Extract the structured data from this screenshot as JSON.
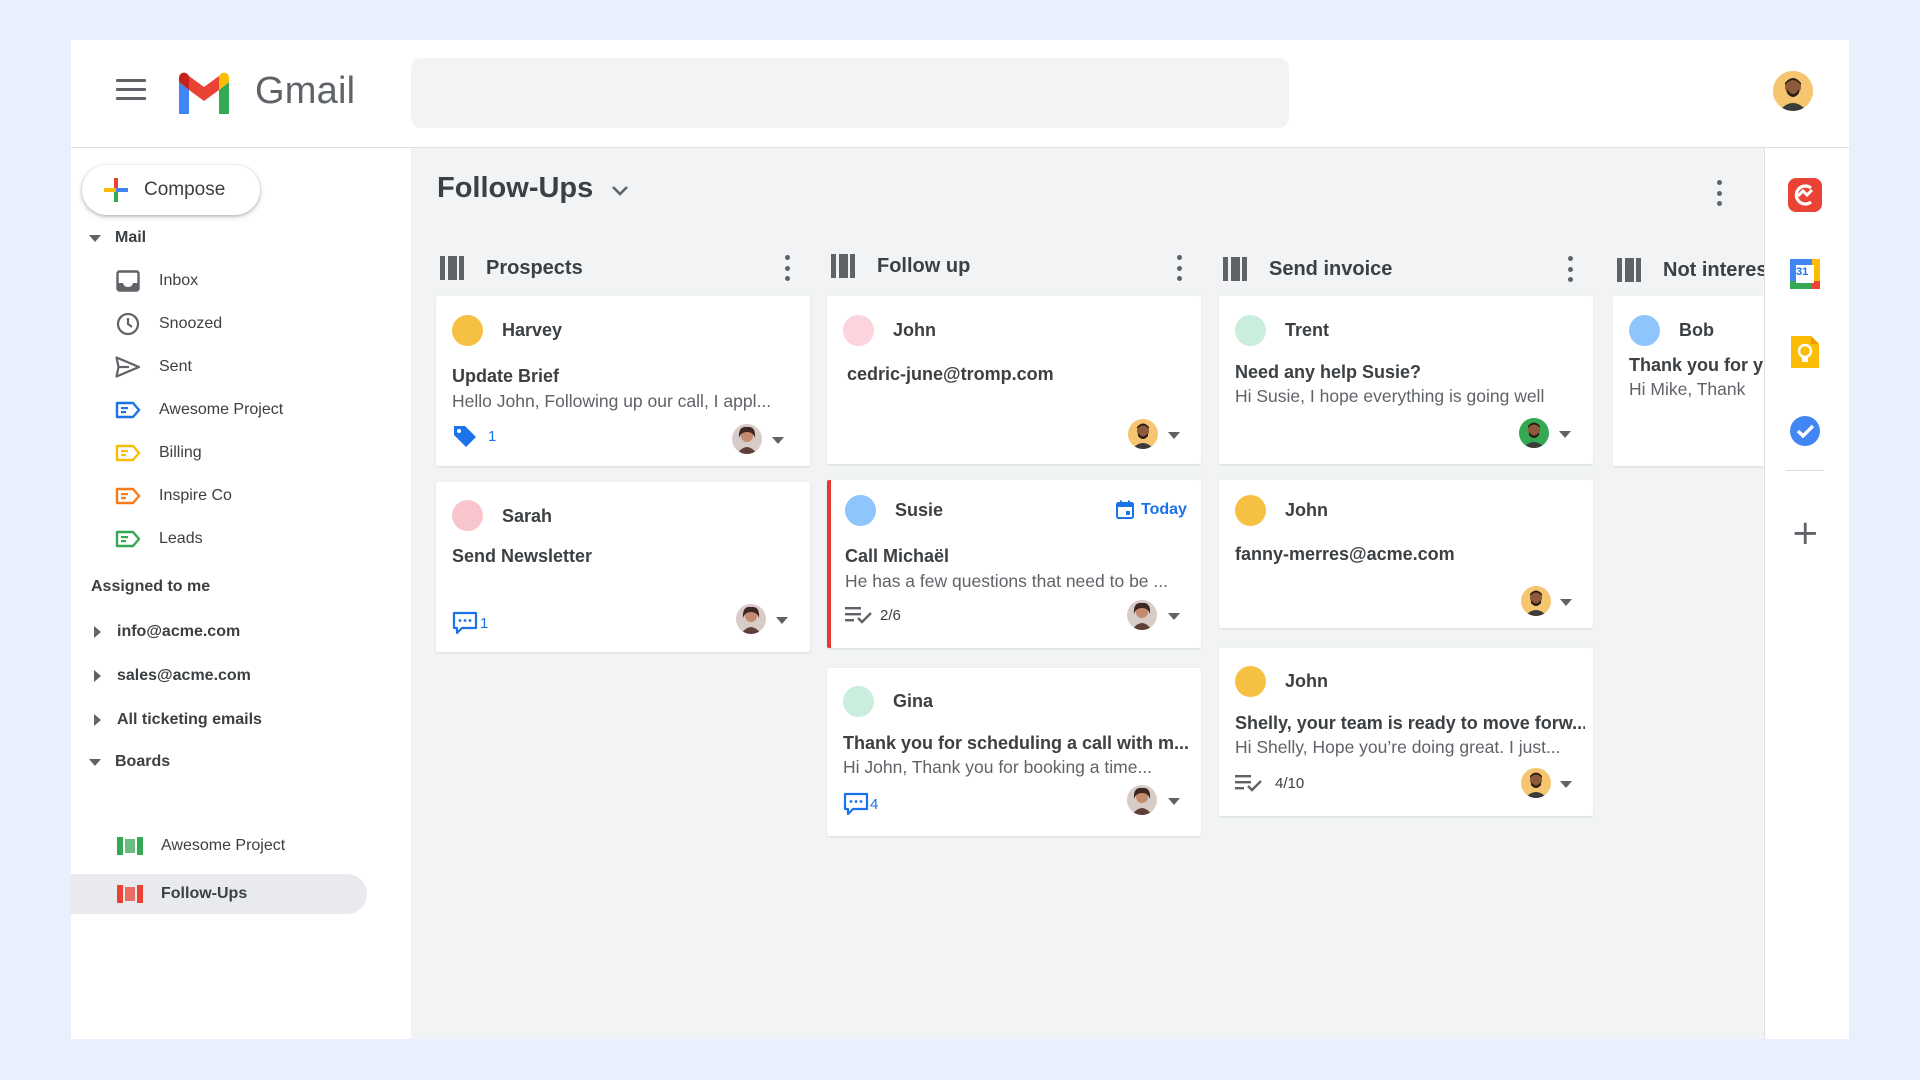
{
  "app": {
    "name": "Gmail"
  },
  "search": {
    "placeholder": ""
  },
  "sidebar": {
    "compose_label": "Compose",
    "mail_label": "Mail",
    "mail_items": [
      {
        "label": "Inbox",
        "icon": "inbox-icon"
      },
      {
        "label": "Snoozed",
        "icon": "clock-icon"
      },
      {
        "label": "Sent",
        "icon": "send-icon"
      },
      {
        "label": "Awesome Project",
        "icon": "label-icon",
        "color": "#1a73e8"
      },
      {
        "label": "Billing",
        "icon": "label-icon",
        "color": "#fbbc04"
      },
      {
        "label": "Inspire Co",
        "icon": "label-icon",
        "color": "#fa7b17"
      },
      {
        "label": "Leads",
        "icon": "label-icon",
        "color": "#34a853"
      }
    ],
    "assigned_label": "Assigned to me",
    "shared_inboxes": [
      "info@acme.com",
      "sales@acme.com",
      "All ticketing emails"
    ],
    "boards_label": "Boards",
    "boards": [
      {
        "label": "Awesome Project",
        "color": "#34a853",
        "active": false
      },
      {
        "label": "Follow-Ups",
        "color": "#ea4335",
        "active": true
      }
    ]
  },
  "board": {
    "title": "Follow-Ups",
    "columns": [
      {
        "name": "Prospects",
        "cards": [
          {
            "name": "Harvey",
            "dot": "#f6c143",
            "subject": "Update Brief",
            "preview": "Hello John, Following up our call, I appl...",
            "meta_icon": "tag-icon",
            "meta_value": "1"
          },
          {
            "name": "Sarah",
            "dot": "#f8c5cc",
            "subject": "Send Newsletter",
            "preview": "",
            "meta_icon": "comment-icon",
            "meta_value": "1"
          }
        ]
      },
      {
        "name": "Follow up",
        "cards": [
          {
            "name": "John",
            "dot": "#fcd4dd",
            "subject": "cedric-june@tromp.com",
            "preview": "",
            "meta_icon": "",
            "meta_value": ""
          },
          {
            "name": "Susie",
            "dot": "#8ec5fc",
            "subject": "Call Michaël",
            "preview": "He has a few questions that need to be ...",
            "meta_icon": "checklist-icon",
            "meta_value": "2/6",
            "due": "Today"
          },
          {
            "name": "Gina",
            "dot": "#c9eede",
            "subject": "Thank you for scheduling a call with m...",
            "preview": "Hi John, Thank you for booking a time...",
            "meta_icon": "comment-icon",
            "meta_value": "4"
          }
        ]
      },
      {
        "name": "Send invoice",
        "cards": [
          {
            "name": "Trent",
            "dot": "#c9eede",
            "subject": "Need any help Susie?",
            "preview": "Hi Susie, I hope everything is going well",
            "meta_icon": "",
            "meta_value": ""
          },
          {
            "name": "John",
            "dot": "#f6c143",
            "subject": "fanny-merres@acme.com",
            "preview": "",
            "meta_icon": "",
            "meta_value": ""
          },
          {
            "name": "John",
            "dot": "#f6c143",
            "subject": "Shelly, your team is ready to move forw...",
            "preview": "Hi Shelly, Hope you’re doing great. I just...",
            "meta_icon": "checklist-icon",
            "meta_value": "4/10"
          }
        ]
      },
      {
        "name": "Not interes",
        "cards": [
          {
            "name": "Bob",
            "dot": "#8ec5fc",
            "subject": "Thank you for y",
            "preview": "Hi Mike, Thank",
            "meta_icon": "",
            "meta_value": ""
          }
        ]
      }
    ]
  },
  "rail": {
    "apps": [
      "streak-icon",
      "calendar-icon",
      "keep-icon",
      "tasks-icon"
    ],
    "calendar_day": "31",
    "add_symbol": "+"
  }
}
